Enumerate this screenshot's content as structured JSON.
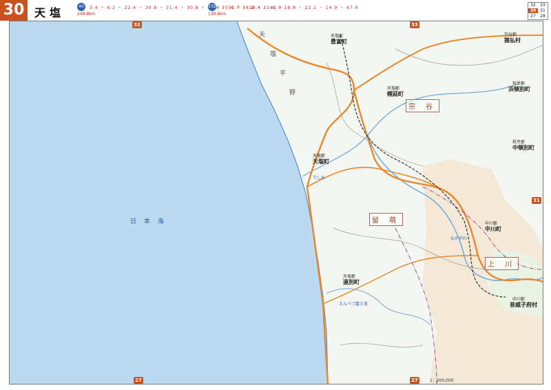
{
  "page": {
    "number": "30",
    "title": "天塩"
  },
  "routes": [
    {
      "shield": "40",
      "length": "249.8km",
      "distances": "3.4 ・ 6.2 ・ 22.4 ・ 30.8 ・ 31.4 ・ 30.8 ・ 40.4 ・ 51.7 ・ 38.4 ・ 42.9"
    },
    {
      "shield": "232",
      "length": "130.6km",
      "distances": "15.4 ・ 18.2 ・ 22.4 ・ 18.8 ・ 22.1 ・ 14.9 ・ 47.0"
    }
  ],
  "index": {
    "top_left": "32",
    "top_right": "33",
    "mid_left": "30",
    "mid_right": "31",
    "bot_left": "27",
    "bot_right": "28"
  },
  "edges": {
    "top_left": "32",
    "top_right": "33",
    "right": "31",
    "bottom_left": "27",
    "bottom_right": "27"
  },
  "sea_label": "日 本 海",
  "regions": [
    "宗 谷",
    "留 萌",
    "上 川"
  ],
  "areas": [
    "天",
    "塩",
    "平",
    "野"
  ],
  "towns": [
    {
      "district": "天塩郡",
      "name": "豊富町"
    },
    {
      "district": "天塩郡",
      "name": "幌延町"
    },
    {
      "district": "天塩郡",
      "name": "天塩町"
    },
    {
      "district": "天塩郡",
      "name": "遠別町"
    },
    {
      "district": "宗谷郡",
      "name": "猿払村"
    },
    {
      "district": "枝幸郡",
      "name": "浜頓別町"
    },
    {
      "district": "枝幸郡",
      "name": "中頓別町"
    },
    {
      "district": "中川郡",
      "name": "中川町"
    },
    {
      "district": "中川郡",
      "name": "音威子府村"
    }
  ],
  "pois": [
    "てしお",
    "えんべつ富士見",
    "なかがわ"
  ],
  "scale": "1：200,000",
  "colors": {
    "sea": "#bcd9f2",
    "land": "#f4f7f1",
    "main_road": "#e8872b",
    "route_shield": "#2b62b8",
    "accent": "#c8531e",
    "river": "#6aa5d8",
    "rail": "#333333"
  }
}
